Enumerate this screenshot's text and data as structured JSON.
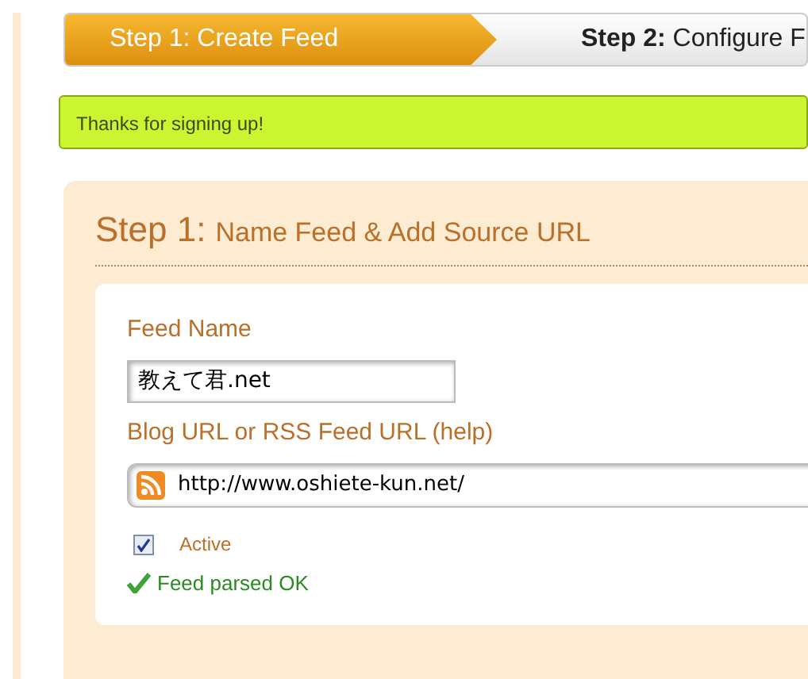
{
  "steps": [
    {
      "label": "Step 1: Create Feed",
      "selected": true
    },
    {
      "label": "**Step 2:** Configure F",
      "selected": false
    }
  ],
  "alert": "Thanks for signing up!",
  "section": {
    "step": "Step 1:",
    "title": "Name Feed & Add Source URL"
  },
  "form": {
    "feed_name": {
      "label": "Feed Name",
      "value": "教えて君.net"
    },
    "source_url": {
      "label": "Blog URL or RSS Feed URL (help)",
      "value": "http://www.oshiete-kun.net/"
    },
    "active": {
      "label": "Active",
      "checked": true
    },
    "status": "Feed parsed OK"
  }
}
